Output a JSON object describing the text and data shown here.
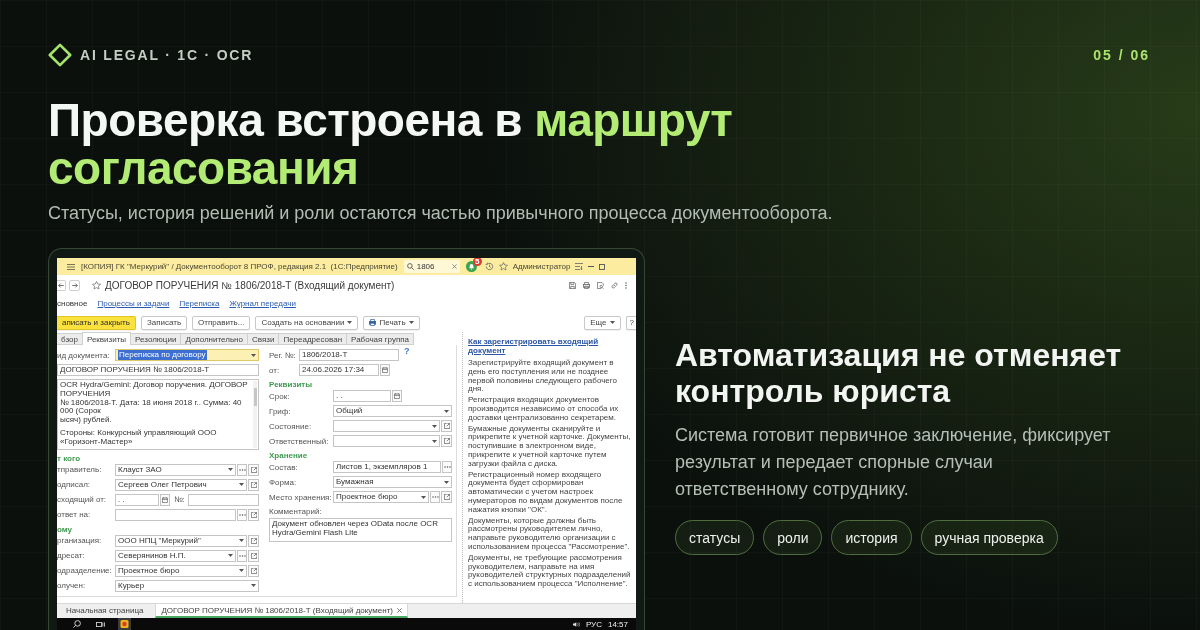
{
  "header": {
    "brand": "AI LEGAL · 1C · OCR",
    "page": "05 / 06"
  },
  "title": {
    "lead": "Проверка встроена в",
    "highlight": "маршрут согласования"
  },
  "subtitle": "Статусы, история решений и роли остаются частью привычного процесса документооборота.",
  "app_window": {
    "title_bar": {
      "title": "[КОПИЯ] ГК \"Меркурий\" / Документооборот 8 ПРОФ, редакция 2.1  (1С:Предприятие)",
      "search": "1806",
      "badge": "5",
      "user": "Администратор"
    },
    "document_title": "ДОГОВОР ПОРУЧЕНИЯ № 1806/2018-Т (Входящий документ)",
    "nav": [
      {
        "label": "сновное",
        "selected": true
      },
      {
        "label": "Процессы и задачи",
        "selected": false
      },
      {
        "label": "Переписка",
        "selected": false
      },
      {
        "label": "Журнал передачи",
        "selected": false
      }
    ],
    "toolbar": [
      {
        "label": "аписать и закрыть",
        "kind": "primary"
      },
      {
        "label": "Записать",
        "kind": "plain"
      },
      {
        "label": "Отправить...",
        "kind": "plain"
      },
      {
        "label": "Создать на основании",
        "kind": "menu"
      },
      {
        "label": "Печать",
        "kind": "print"
      }
    ],
    "toolbar_right": [
      {
        "label": "Еще",
        "kind": "menu"
      },
      {
        "label": "?",
        "kind": "plain"
      }
    ],
    "tabs": [
      {
        "label": "бзор",
        "selected": false
      },
      {
        "label": "Реквизиты",
        "selected": true
      },
      {
        "label": "Резолюции",
        "selected": false
      },
      {
        "label": "Дополнительно",
        "selected": false
      },
      {
        "label": "Связи",
        "selected": false
      },
      {
        "label": "Переадресован",
        "selected": false
      },
      {
        "label": "Рабочая группа",
        "selected": false
      }
    ],
    "left_fields": [
      {
        "kind": "select",
        "label": "ид документа:",
        "value": "Переписка по договору",
        "focused": true
      },
      {
        "kind": "text",
        "value": "ДОГОВОР ПОРУЧЕНИЯ № 1806/2018-Т",
        "focused": false
      },
      {
        "kind": "memo",
        "paragraphs": [
          [
            "OCR Hydra/Gemini: Договор поручения. ДОГОВОР ПОРУЧЕНИЯ",
            "№ 1806/2018-Т. Дата: 18 июня 2018 г.. Сумма: 40 000 (Сорок",
            "ысяч) рублей."
          ],
          [
            "Стороны: Конкурсный управляющий ООО «Горизонт-Мастер»"
          ]
        ],
        "focused": false
      },
      {
        "kind": "section",
        "label": "т кого"
      },
      {
        "kind": "select-pick-link",
        "label": "тправитель:",
        "value": "Клауст ЗАО",
        "focused": false
      },
      {
        "kind": "select-link",
        "label": "одписал:",
        "value": "Сергеев Олег Петрович",
        "focused": false
      },
      {
        "kind": "date-number",
        "label": "сходящий от:",
        "value": ". .",
        "number_label": "№:",
        "focused": false
      },
      {
        "kind": "pick-link",
        "label": "ответ на:",
        "focused": false
      },
      {
        "kind": "section",
        "label": "ому"
      },
      {
        "kind": "select-link",
        "label": "рганизация:",
        "value": "ООО НПЦ \"Меркурий\"",
        "focused": false
      },
      {
        "kind": "select-pick-link",
        "label": "дресат:",
        "value": "Северянинов Н.П.",
        "focused": false
      },
      {
        "kind": "select-link",
        "label": "одразделение:",
        "value": "Проектное бюро",
        "focused": false
      },
      {
        "kind": "select",
        "label": "олучен:",
        "value": "Курьер",
        "focused": false
      }
    ],
    "registration": [
      {
        "kind": "text",
        "label": "Рег. №:",
        "value": "1806/2018-Т",
        "focused": false
      },
      {
        "kind": "date",
        "label": "от:",
        "value": "24.06.2026 17:34",
        "focused": false
      }
    ],
    "help_mark": "?",
    "right_fields": [
      {
        "kind": "section",
        "label": "Реквизиты"
      },
      {
        "kind": "date",
        "label": "Срок:",
        "value": ". .",
        "focused": false
      },
      {
        "kind": "select",
        "label": "Гриф:",
        "value": "Общий",
        "focused": false
      },
      {
        "kind": "select-link",
        "label": "Состояние:",
        "focused": false
      },
      {
        "kind": "select-link",
        "label": "Ответственный:",
        "focused": false
      },
      {
        "kind": "section",
        "label": "Хранение"
      },
      {
        "kind": "pick",
        "label": "Состав:",
        "value": "Листов 1, экземпляров 1",
        "focused": false
      },
      {
        "kind": "select",
        "label": "Форма:",
        "value": "Бумажная",
        "focused": false
      },
      {
        "kind": "select-pick-link",
        "label": "Место хранения:",
        "value": "Проектное бюро",
        "focused": false
      },
      {
        "kind": "memo",
        "label": "Комментарий:",
        "value": "Документ обновлен через OData после OCR Hydra/Gemini Flash Lite",
        "focused": false
      }
    ],
    "help": {
      "title": "Как зарегистрировать входящий документ",
      "paragraphs": [
        "Зарегистрируйте входящий документ в день его поступления или не позднее первой половины следующего рабочего дня.",
        "Регистрация входящих документов производится независимо от способа их доставки централизованно секретарем.",
        "Бумажные документы сканируйте и прикрепите к учетной карточке. Документы, поступившие в электронном виде, прикрепите к учетной карточке путем загрузки файла с диска.",
        "Регистрационный номер входящего документа будет сформирован автоматически с учетом настроек нумераторов по видам документов после нажатия кнопки \"ОК\".",
        "Документы, которые должны быть рассмотрены руководителем лично, направьте руководителю организации с использованием процесса \"Рассмотрение\".",
        "Документы, не требующие рассмотрения руководителем, направьте на имя руководителей структурных подразделений с использованием процесса \"Исполнение\"."
      ]
    },
    "open_tabs": [
      {
        "label": "Начальная страница",
        "selected": false,
        "closable": false
      },
      {
        "label": "ДОГОВОР ПОРУЧЕНИЯ № 1806/2018-Т (Входящий документ)",
        "selected": true,
        "closable": true
      }
    ],
    "taskbar": {
      "language": "РУС",
      "time": "14:57"
    }
  },
  "aside": {
    "heading": "Автоматизация не отменяет контроль юриста",
    "text": "Система готовит первичное заключение, фиксирует результат и передает спорные случаи ответственному сотруднику.",
    "tags": [
      "статусы",
      "роли",
      "история",
      "ручная проверка"
    ]
  }
}
